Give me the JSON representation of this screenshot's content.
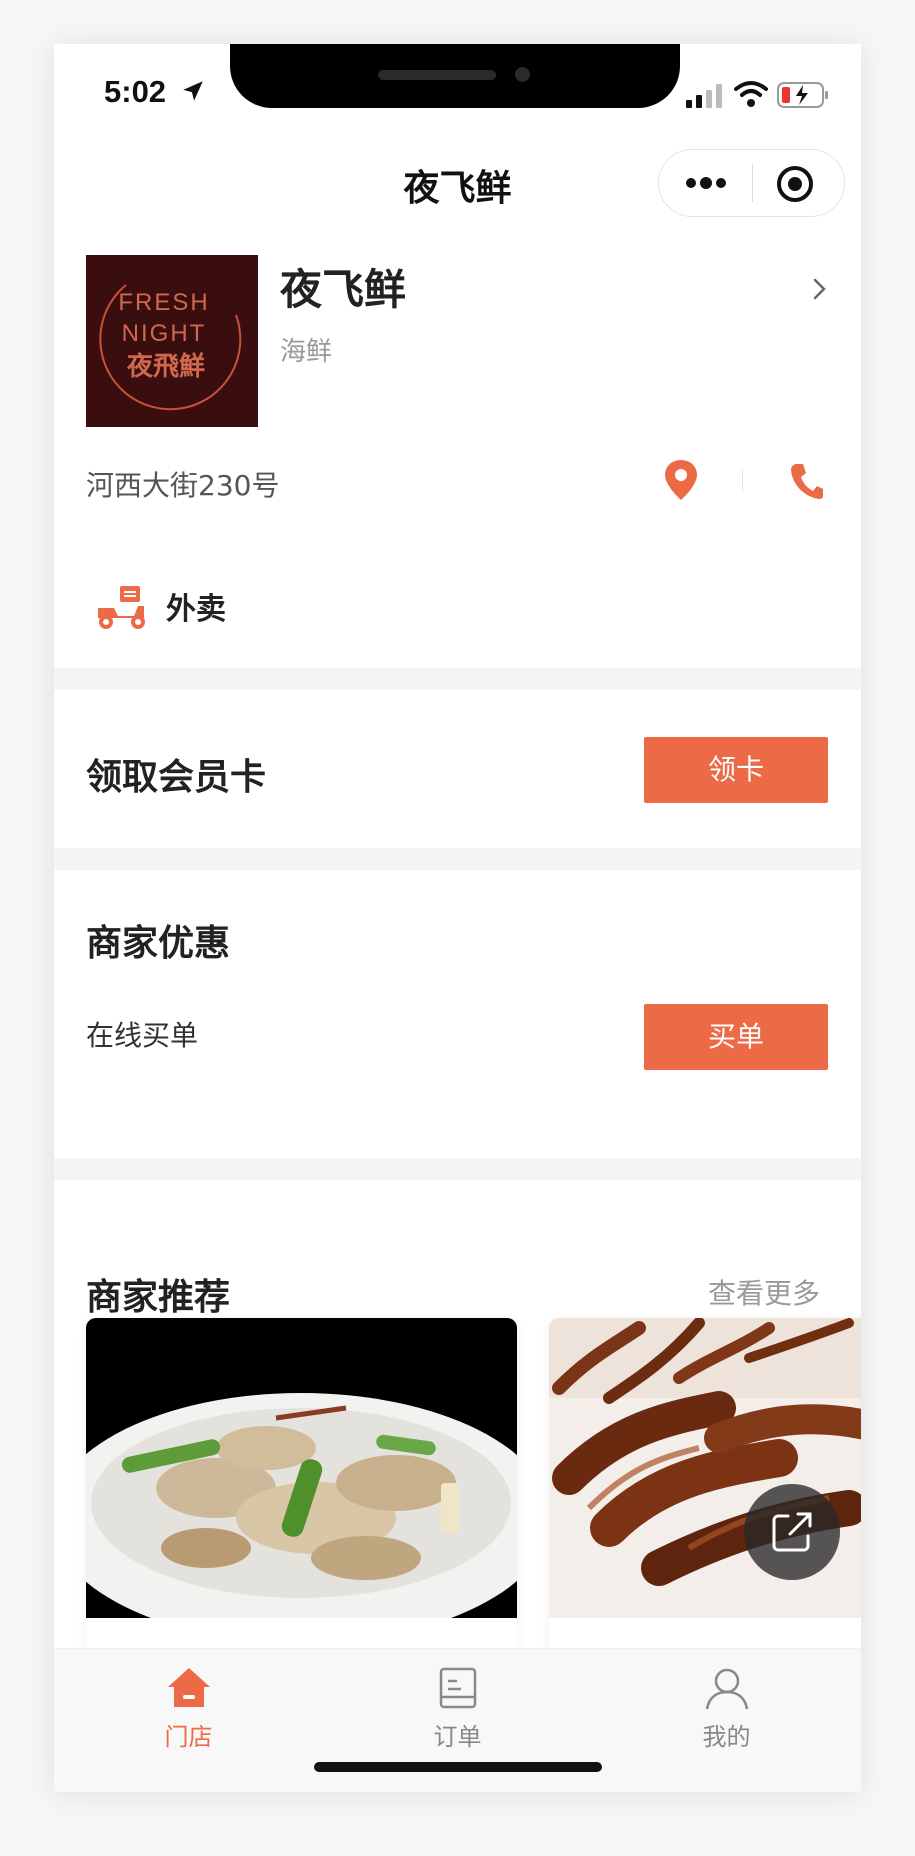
{
  "status_bar": {
    "time": "5:02"
  },
  "nav": {
    "title": "夜飞鲜"
  },
  "store": {
    "name": "夜飞鲜",
    "category": "海鲜",
    "address": "河西大街230号",
    "logo_text": [
      "FRESH",
      "NIGHT",
      "夜飛鮮"
    ],
    "service": "外卖"
  },
  "member_card": {
    "title": "领取会员卡",
    "button": "领卡"
  },
  "offers": {
    "title": "商家优惠",
    "item": "在线买单",
    "button": "买单"
  },
  "recommend": {
    "title": "商家推荐",
    "more": "查看更多"
  },
  "tabs": [
    {
      "label": "门店",
      "icon": "home-icon",
      "active": true
    },
    {
      "label": "订单",
      "icon": "order-icon",
      "active": false
    },
    {
      "label": "我的",
      "icon": "user-icon",
      "active": false
    }
  ],
  "colors": {
    "accent": "#ec6a45",
    "logo_bg": "#3a0d0e"
  }
}
